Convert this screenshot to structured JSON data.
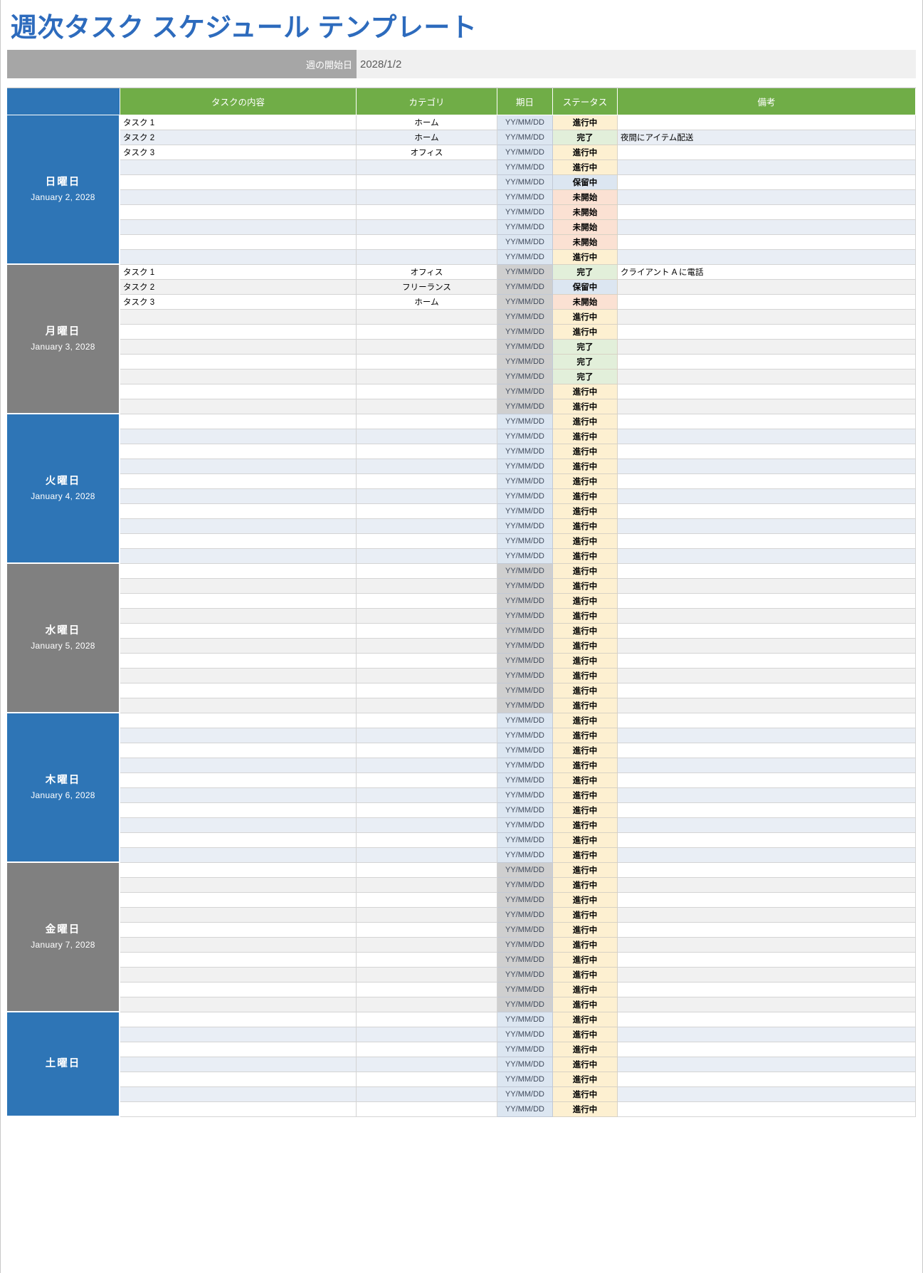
{
  "title": "週次タスク スケジュール テンプレート",
  "week_start": {
    "label": "週の開始日",
    "value": "2028/1/2"
  },
  "columns": {
    "day": "",
    "task": "タスクの内容",
    "category": "カテゴリ",
    "due": "期日",
    "status": "ステータス",
    "notes": "備考"
  },
  "status_colors": {
    "progress": "#fdf0d1",
    "done": "#e2efda",
    "hold": "#dce6f1",
    "not_started": "#fbe1d3"
  },
  "accent_colors": {
    "title": "#2d6bbd",
    "header_green": "#70ad47",
    "day_blue": "#2e75b6",
    "day_gray": "#808080",
    "band_gray": "#a6a6a6"
  },
  "status_labels": {
    "progress": "進行中",
    "done": "完了",
    "hold": "保留中",
    "not_started": "未開始"
  },
  "due_placeholder": "YY/MM/DD",
  "days": [
    {
      "name": "日曜日",
      "date": "January 2, 2028",
      "color": "blue",
      "rows": [
        {
          "task": "タスク 1",
          "category": "ホーム",
          "due": "YY/MM/DD",
          "status": "進行中",
          "status_key": "progress",
          "notes": ""
        },
        {
          "task": "タスク 2",
          "category": "ホーム",
          "due": "YY/MM/DD",
          "status": "完了",
          "status_key": "done",
          "notes": "夜間にアイテム配送"
        },
        {
          "task": "タスク 3",
          "category": "オフィス",
          "due": "YY/MM/DD",
          "status": "進行中",
          "status_key": "progress",
          "notes": ""
        },
        {
          "task": "",
          "category": "",
          "due": "YY/MM/DD",
          "status": "進行中",
          "status_key": "progress",
          "notes": ""
        },
        {
          "task": "",
          "category": "",
          "due": "YY/MM/DD",
          "status": "保留中",
          "status_key": "hold",
          "notes": ""
        },
        {
          "task": "",
          "category": "",
          "due": "YY/MM/DD",
          "status": "未開始",
          "status_key": "not_started",
          "notes": ""
        },
        {
          "task": "",
          "category": "",
          "due": "YY/MM/DD",
          "status": "未開始",
          "status_key": "not_started",
          "notes": ""
        },
        {
          "task": "",
          "category": "",
          "due": "YY/MM/DD",
          "status": "未開始",
          "status_key": "not_started",
          "notes": ""
        },
        {
          "task": "",
          "category": "",
          "due": "YY/MM/DD",
          "status": "未開始",
          "status_key": "not_started",
          "notes": ""
        },
        {
          "task": "",
          "category": "",
          "due": "YY/MM/DD",
          "status": "進行中",
          "status_key": "progress",
          "notes": ""
        }
      ]
    },
    {
      "name": "月曜日",
      "date": "January 3, 2028",
      "color": "gray",
      "rows": [
        {
          "task": "タスク 1",
          "category": "オフィス",
          "due": "YY/MM/DD",
          "status": "完了",
          "status_key": "done",
          "notes": "クライアント A に電話"
        },
        {
          "task": "タスク 2",
          "category": "フリーランス",
          "due": "YY/MM/DD",
          "status": "保留中",
          "status_key": "hold",
          "notes": ""
        },
        {
          "task": "タスク 3",
          "category": "ホーム",
          "due": "YY/MM/DD",
          "status": "未開始",
          "status_key": "not_started",
          "notes": ""
        },
        {
          "task": "",
          "category": "",
          "due": "YY/MM/DD",
          "status": "進行中",
          "status_key": "progress",
          "notes": ""
        },
        {
          "task": "",
          "category": "",
          "due": "YY/MM/DD",
          "status": "進行中",
          "status_key": "progress",
          "notes": ""
        },
        {
          "task": "",
          "category": "",
          "due": "YY/MM/DD",
          "status": "完了",
          "status_key": "done",
          "notes": ""
        },
        {
          "task": "",
          "category": "",
          "due": "YY/MM/DD",
          "status": "完了",
          "status_key": "done",
          "notes": ""
        },
        {
          "task": "",
          "category": "",
          "due": "YY/MM/DD",
          "status": "完了",
          "status_key": "done",
          "notes": ""
        },
        {
          "task": "",
          "category": "",
          "due": "YY/MM/DD",
          "status": "進行中",
          "status_key": "progress",
          "notes": ""
        },
        {
          "task": "",
          "category": "",
          "due": "YY/MM/DD",
          "status": "進行中",
          "status_key": "progress",
          "notes": ""
        }
      ]
    },
    {
      "name": "火曜日",
      "date": "January 4, 2028",
      "color": "blue",
      "rows": [
        {
          "task": "",
          "category": "",
          "due": "YY/MM/DD",
          "status": "進行中",
          "status_key": "progress",
          "notes": ""
        },
        {
          "task": "",
          "category": "",
          "due": "YY/MM/DD",
          "status": "進行中",
          "status_key": "progress",
          "notes": ""
        },
        {
          "task": "",
          "category": "",
          "due": "YY/MM/DD",
          "status": "進行中",
          "status_key": "progress",
          "notes": ""
        },
        {
          "task": "",
          "category": "",
          "due": "YY/MM/DD",
          "status": "進行中",
          "status_key": "progress",
          "notes": ""
        },
        {
          "task": "",
          "category": "",
          "due": "YY/MM/DD",
          "status": "進行中",
          "status_key": "progress",
          "notes": ""
        },
        {
          "task": "",
          "category": "",
          "due": "YY/MM/DD",
          "status": "進行中",
          "status_key": "progress",
          "notes": ""
        },
        {
          "task": "",
          "category": "",
          "due": "YY/MM/DD",
          "status": "進行中",
          "status_key": "progress",
          "notes": ""
        },
        {
          "task": "",
          "category": "",
          "due": "YY/MM/DD",
          "status": "進行中",
          "status_key": "progress",
          "notes": ""
        },
        {
          "task": "",
          "category": "",
          "due": "YY/MM/DD",
          "status": "進行中",
          "status_key": "progress",
          "notes": ""
        },
        {
          "task": "",
          "category": "",
          "due": "YY/MM/DD",
          "status": "進行中",
          "status_key": "progress",
          "notes": ""
        }
      ]
    },
    {
      "name": "水曜日",
      "date": "January 5, 2028",
      "color": "gray",
      "rows": [
        {
          "task": "",
          "category": "",
          "due": "YY/MM/DD",
          "status": "進行中",
          "status_key": "progress",
          "notes": ""
        },
        {
          "task": "",
          "category": "",
          "due": "YY/MM/DD",
          "status": "進行中",
          "status_key": "progress",
          "notes": ""
        },
        {
          "task": "",
          "category": "",
          "due": "YY/MM/DD",
          "status": "進行中",
          "status_key": "progress",
          "notes": ""
        },
        {
          "task": "",
          "category": "",
          "due": "YY/MM/DD",
          "status": "進行中",
          "status_key": "progress",
          "notes": ""
        },
        {
          "task": "",
          "category": "",
          "due": "YY/MM/DD",
          "status": "進行中",
          "status_key": "progress",
          "notes": ""
        },
        {
          "task": "",
          "category": "",
          "due": "YY/MM/DD",
          "status": "進行中",
          "status_key": "progress",
          "notes": ""
        },
        {
          "task": "",
          "category": "",
          "due": "YY/MM/DD",
          "status": "進行中",
          "status_key": "progress",
          "notes": ""
        },
        {
          "task": "",
          "category": "",
          "due": "YY/MM/DD",
          "status": "進行中",
          "status_key": "progress",
          "notes": ""
        },
        {
          "task": "",
          "category": "",
          "due": "YY/MM/DD",
          "status": "進行中",
          "status_key": "progress",
          "notes": ""
        },
        {
          "task": "",
          "category": "",
          "due": "YY/MM/DD",
          "status": "進行中",
          "status_key": "progress",
          "notes": ""
        }
      ]
    },
    {
      "name": "木曜日",
      "date": "January 6, 2028",
      "color": "blue",
      "rows": [
        {
          "task": "",
          "category": "",
          "due": "YY/MM/DD",
          "status": "進行中",
          "status_key": "progress",
          "notes": ""
        },
        {
          "task": "",
          "category": "",
          "due": "YY/MM/DD",
          "status": "進行中",
          "status_key": "progress",
          "notes": ""
        },
        {
          "task": "",
          "category": "",
          "due": "YY/MM/DD",
          "status": "進行中",
          "status_key": "progress",
          "notes": ""
        },
        {
          "task": "",
          "category": "",
          "due": "YY/MM/DD",
          "status": "進行中",
          "status_key": "progress",
          "notes": ""
        },
        {
          "task": "",
          "category": "",
          "due": "YY/MM/DD",
          "status": "進行中",
          "status_key": "progress",
          "notes": ""
        },
        {
          "task": "",
          "category": "",
          "due": "YY/MM/DD",
          "status": "進行中",
          "status_key": "progress",
          "notes": ""
        },
        {
          "task": "",
          "category": "",
          "due": "YY/MM/DD",
          "status": "進行中",
          "status_key": "progress",
          "notes": ""
        },
        {
          "task": "",
          "category": "",
          "due": "YY/MM/DD",
          "status": "進行中",
          "status_key": "progress",
          "notes": ""
        },
        {
          "task": "",
          "category": "",
          "due": "YY/MM/DD",
          "status": "進行中",
          "status_key": "progress",
          "notes": ""
        },
        {
          "task": "",
          "category": "",
          "due": "YY/MM/DD",
          "status": "進行中",
          "status_key": "progress",
          "notes": ""
        }
      ]
    },
    {
      "name": "金曜日",
      "date": "January 7, 2028",
      "color": "gray",
      "rows": [
        {
          "task": "",
          "category": "",
          "due": "YY/MM/DD",
          "status": "進行中",
          "status_key": "progress",
          "notes": ""
        },
        {
          "task": "",
          "category": "",
          "due": "YY/MM/DD",
          "status": "進行中",
          "status_key": "progress",
          "notes": ""
        },
        {
          "task": "",
          "category": "",
          "due": "YY/MM/DD",
          "status": "進行中",
          "status_key": "progress",
          "notes": ""
        },
        {
          "task": "",
          "category": "",
          "due": "YY/MM/DD",
          "status": "進行中",
          "status_key": "progress",
          "notes": ""
        },
        {
          "task": "",
          "category": "",
          "due": "YY/MM/DD",
          "status": "進行中",
          "status_key": "progress",
          "notes": ""
        },
        {
          "task": "",
          "category": "",
          "due": "YY/MM/DD",
          "status": "進行中",
          "status_key": "progress",
          "notes": ""
        },
        {
          "task": "",
          "category": "",
          "due": "YY/MM/DD",
          "status": "進行中",
          "status_key": "progress",
          "notes": ""
        },
        {
          "task": "",
          "category": "",
          "due": "YY/MM/DD",
          "status": "進行中",
          "status_key": "progress",
          "notes": ""
        },
        {
          "task": "",
          "category": "",
          "due": "YY/MM/DD",
          "status": "進行中",
          "status_key": "progress",
          "notes": ""
        },
        {
          "task": "",
          "category": "",
          "due": "YY/MM/DD",
          "status": "進行中",
          "status_key": "progress",
          "notes": ""
        }
      ]
    },
    {
      "name": "土曜日",
      "date": "",
      "color": "blue",
      "rows": [
        {
          "task": "",
          "category": "",
          "due": "YY/MM/DD",
          "status": "進行中",
          "status_key": "progress",
          "notes": ""
        },
        {
          "task": "",
          "category": "",
          "due": "YY/MM/DD",
          "status": "進行中",
          "status_key": "progress",
          "notes": ""
        },
        {
          "task": "",
          "category": "",
          "due": "YY/MM/DD",
          "status": "進行中",
          "status_key": "progress",
          "notes": ""
        },
        {
          "task": "",
          "category": "",
          "due": "YY/MM/DD",
          "status": "進行中",
          "status_key": "progress",
          "notes": ""
        },
        {
          "task": "",
          "category": "",
          "due": "YY/MM/DD",
          "status": "進行中",
          "status_key": "progress",
          "notes": ""
        },
        {
          "task": "",
          "category": "",
          "due": "YY/MM/DD",
          "status": "進行中",
          "status_key": "progress",
          "notes": ""
        },
        {
          "task": "",
          "category": "",
          "due": "YY/MM/DD",
          "status": "進行中",
          "status_key": "progress",
          "notes": ""
        }
      ]
    }
  ]
}
